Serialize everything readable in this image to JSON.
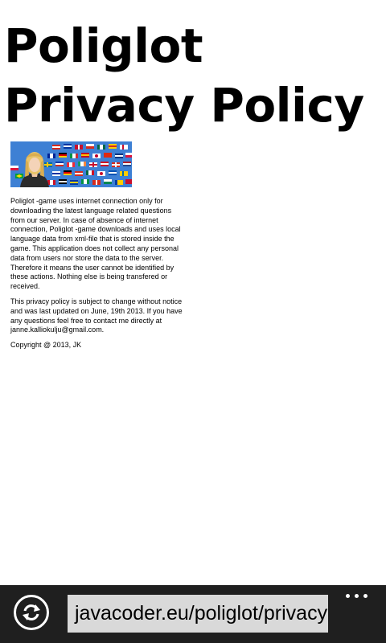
{
  "page": {
    "title": "Poliglot Privacy Policy",
    "image_alt": "woman in front of world flags",
    "paragraphs": [
      "Poliglot -game uses internet connection only for downloading the latest language related questions from our server. In case of absence of internet connection, Poliglot -game downloads and uses local language data from xml-file that is stored inside the game. This application does not collect any personal data from users nor store the data to the server. Therefore it means the user cannot be identified by these actions. Nothing else is being transfered or received.",
      "This privacy policy is subject to change without notice and was last updated on June, 19th 2013. If you have any questions feel free to contact me directly at janne.kalliokulju@gmail.com.",
      "Copyright @ 2013, JK"
    ]
  },
  "appbar": {
    "url": "javacoder.eu/poliglot/privacy",
    "refresh_icon": "refresh-icon",
    "more_icon": "more-dots-icon"
  },
  "colors": {
    "appbar_bg": "#1f1f1f",
    "url_bg": "#d9d9d9",
    "page_bg": "#ffffff"
  }
}
